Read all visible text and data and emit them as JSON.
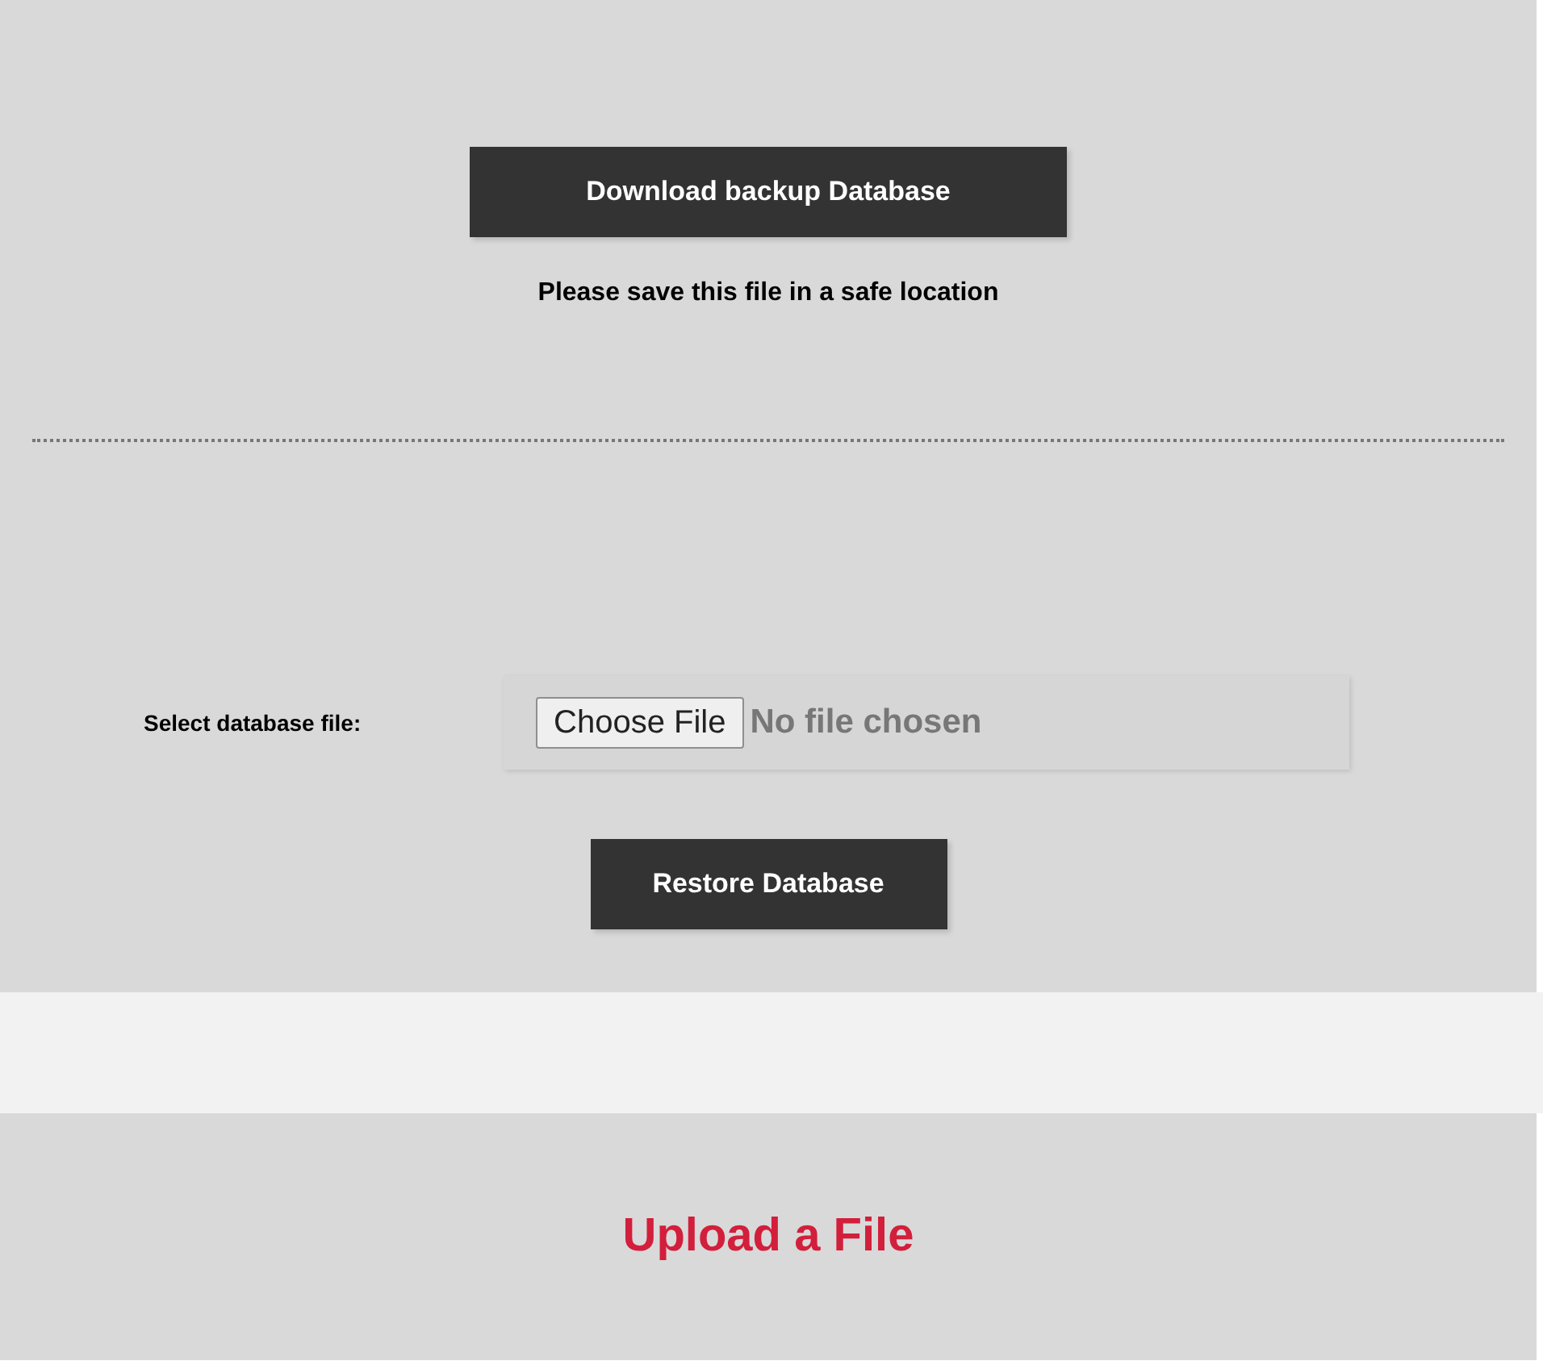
{
  "backup": {
    "download_button": "Download backup Database",
    "note": "Please save this file in a safe location"
  },
  "restore": {
    "label": "Select database file:",
    "file_button": "Choose File",
    "file_status": "No file chosen",
    "restore_button": "Restore Database"
  },
  "upload": {
    "title": "Upload a File"
  }
}
